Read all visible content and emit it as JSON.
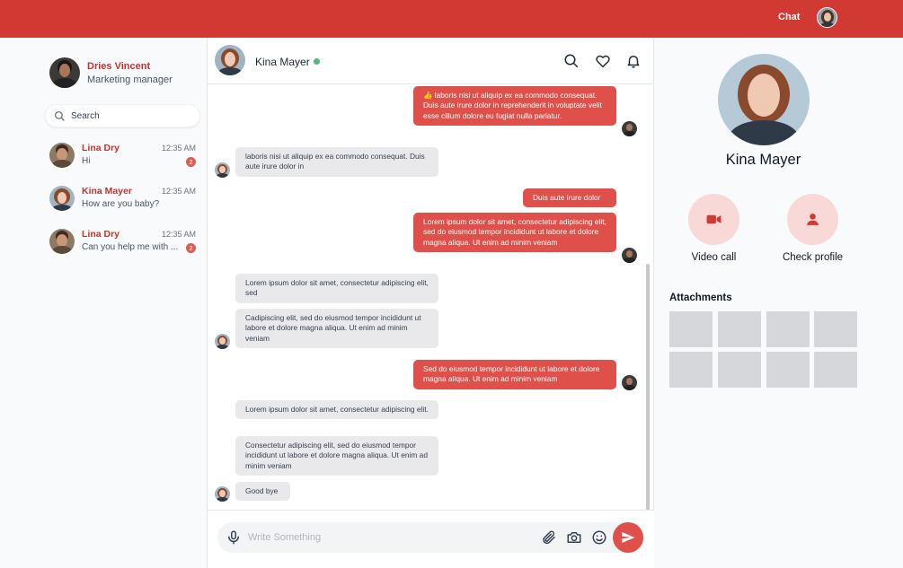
{
  "topbar": {
    "chat_label": "Chat"
  },
  "me": {
    "name": "Dries Vincent",
    "role": "Marketing manager"
  },
  "search": {
    "placeholder": "Search"
  },
  "conversations": [
    {
      "name": "Lina Dry",
      "time": "12:35 AM",
      "preview": "Hi",
      "unread": "2"
    },
    {
      "name": "Kina Mayer",
      "time": "12:35 AM",
      "preview": "How are you baby?",
      "unread": ""
    },
    {
      "name": "Lina Dry",
      "time": "12:35 AM",
      "preview": "Can you help me with ...",
      "unread": "2"
    }
  ],
  "chat": {
    "contact_name": "Kina Mayer",
    "status": "online",
    "icons": [
      "search-icon",
      "heart-icon",
      "bell-icon"
    ],
    "messages": [
      {
        "from": "me",
        "text": "👍 laboris nisi ut aliquip ex ea commodo consequat. Duis aute irure dolor in reprehenderit in voluptate velit esse cillum dolore eu fugiat nulla pariatur."
      },
      {
        "from": "them",
        "text": "laboris nisi ut aliquip ex ea commodo consequat. Duis aute irure dolor in"
      },
      {
        "from": "me",
        "text": "Duis aute irure dolor"
      },
      {
        "from": "me",
        "text": "Lorem ipsum dolor sit amet, consectetur adipiscing elit, sed do eiusmod tempor incididunt ut labore et dolore magna aliqua. Ut enim ad minim veniam"
      },
      {
        "from": "them",
        "text": "Lorem ipsum dolor sit amet, consectetur adipiscing elit, sed"
      },
      {
        "from": "them",
        "text": "Cadipiscing elit, sed do eiusmod tempor incididunt ut labore et dolore magna aliqua. Ut enim ad minim veniam"
      },
      {
        "from": "me",
        "text": "Sed do eiusmod tempor incididunt ut labore et dolore magna aliqua. Ut enim ad minim veniam"
      },
      {
        "from": "them",
        "text": "Lorem ipsum dolor sit amet, consectetur adipiscing elit."
      },
      {
        "from": "them",
        "text": "Consectetur adipiscing elit, sed do eiusmod tempor incididunt ut labore et dolore magna aliqua. Ut enim ad minim veniam"
      },
      {
        "from": "them",
        "text": "Good bye"
      }
    ]
  },
  "composer": {
    "placeholder": "Write Something",
    "icons": [
      "microphone-icon",
      "paperclip-icon",
      "camera-icon",
      "smiley-icon",
      "send-icon"
    ]
  },
  "profile": {
    "name": "Kina Mayer",
    "actions": [
      {
        "label": "Video call",
        "icon": "video-icon"
      },
      {
        "label": "Check profile",
        "icon": "user-icon"
      }
    ],
    "attachments_title": "Attachments",
    "attachment_count": 8
  },
  "colors": {
    "brand": "#d13a32",
    "outgoing_bubble": "#e0504a",
    "incoming_bubble": "#e9e9ec",
    "online": "#4fba7c",
    "action_circle": "#f8d9d7"
  }
}
